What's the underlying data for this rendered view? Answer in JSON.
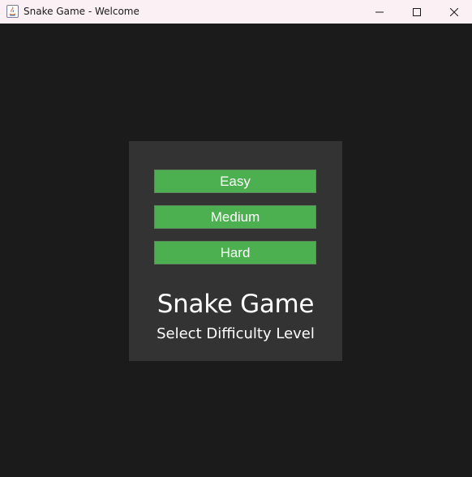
{
  "window": {
    "title": "Snake Game - Welcome",
    "app_icon": "java-icon",
    "controls": {
      "minimize_icon": "minimize-icon",
      "maximize_icon": "maximize-icon",
      "close_icon": "close-icon"
    }
  },
  "menu": {
    "buttons": [
      {
        "label": "Easy"
      },
      {
        "label": "Medium"
      },
      {
        "label": "Hard"
      }
    ],
    "title": "Snake Game",
    "subtitle": "Select Difficulty Level"
  },
  "colors": {
    "background": "#1b1b1b",
    "panel": "#333333",
    "button": "#4caf50",
    "text": "#ffffff",
    "titlebar": "#fbf0f4"
  }
}
